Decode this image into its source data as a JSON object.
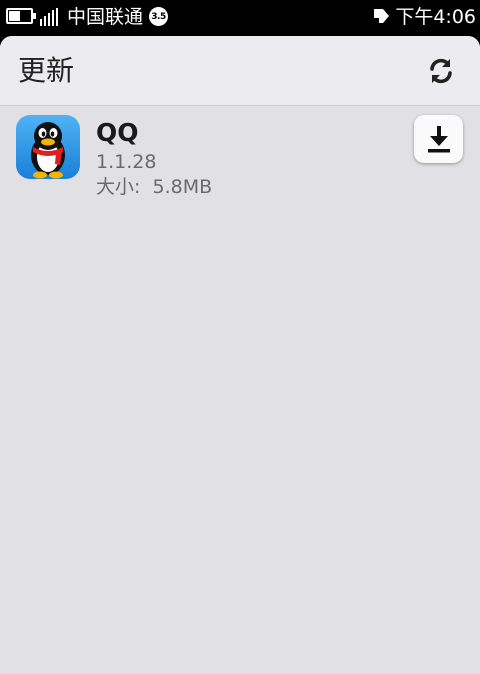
{
  "statusbar": {
    "carrier": "中国联通",
    "network_badge": "3.5",
    "time": "下午4:06",
    "icons": [
      "battery-icon",
      "signal-icon",
      "notification-icon"
    ]
  },
  "header": {
    "title": "更新",
    "refresh_icon": "refresh-icon"
  },
  "updates": [
    {
      "name": "QQ",
      "version": "1.1.28",
      "size_label": "大小:",
      "size_value": "5.8MB",
      "icon": "qq-penguin-icon",
      "action_icon": "download-icon"
    }
  ],
  "colors": {
    "panel_bg": "#e1e1e5",
    "header_bg": "#ececf0",
    "statusbar_bg": "#000000",
    "icon_blue": "#1a7fd8"
  }
}
